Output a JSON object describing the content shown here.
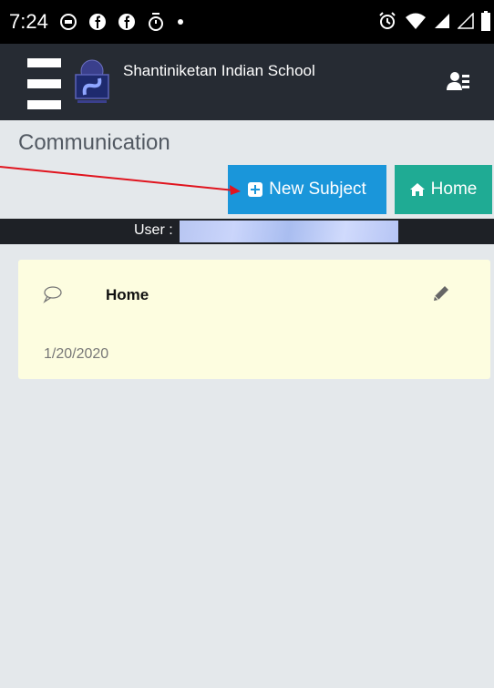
{
  "status_bar": {
    "time": "7:24",
    "left_icons": [
      "message-icon",
      "facebook-icon",
      "facebook-icon",
      "timer-icon",
      "dot-icon"
    ],
    "right_icons": [
      "alarm-icon",
      "wifi-icon",
      "signal-icon",
      "signal-icon",
      "battery-icon"
    ]
  },
  "app_bar": {
    "title": "Shantiniketan Indian School",
    "background": "#262b33"
  },
  "page": {
    "title": "Communication"
  },
  "buttons": {
    "new_subject": "New Subject",
    "home": "Home",
    "new_subject_color": "#1a96da",
    "home_color": "#1fab94"
  },
  "user_strip": {
    "label": "User :"
  },
  "cards": [
    {
      "title": "Home",
      "date": "1/20/2020",
      "background": "#fdfde0"
    }
  ],
  "annotation": {
    "color": "#e0141e"
  }
}
